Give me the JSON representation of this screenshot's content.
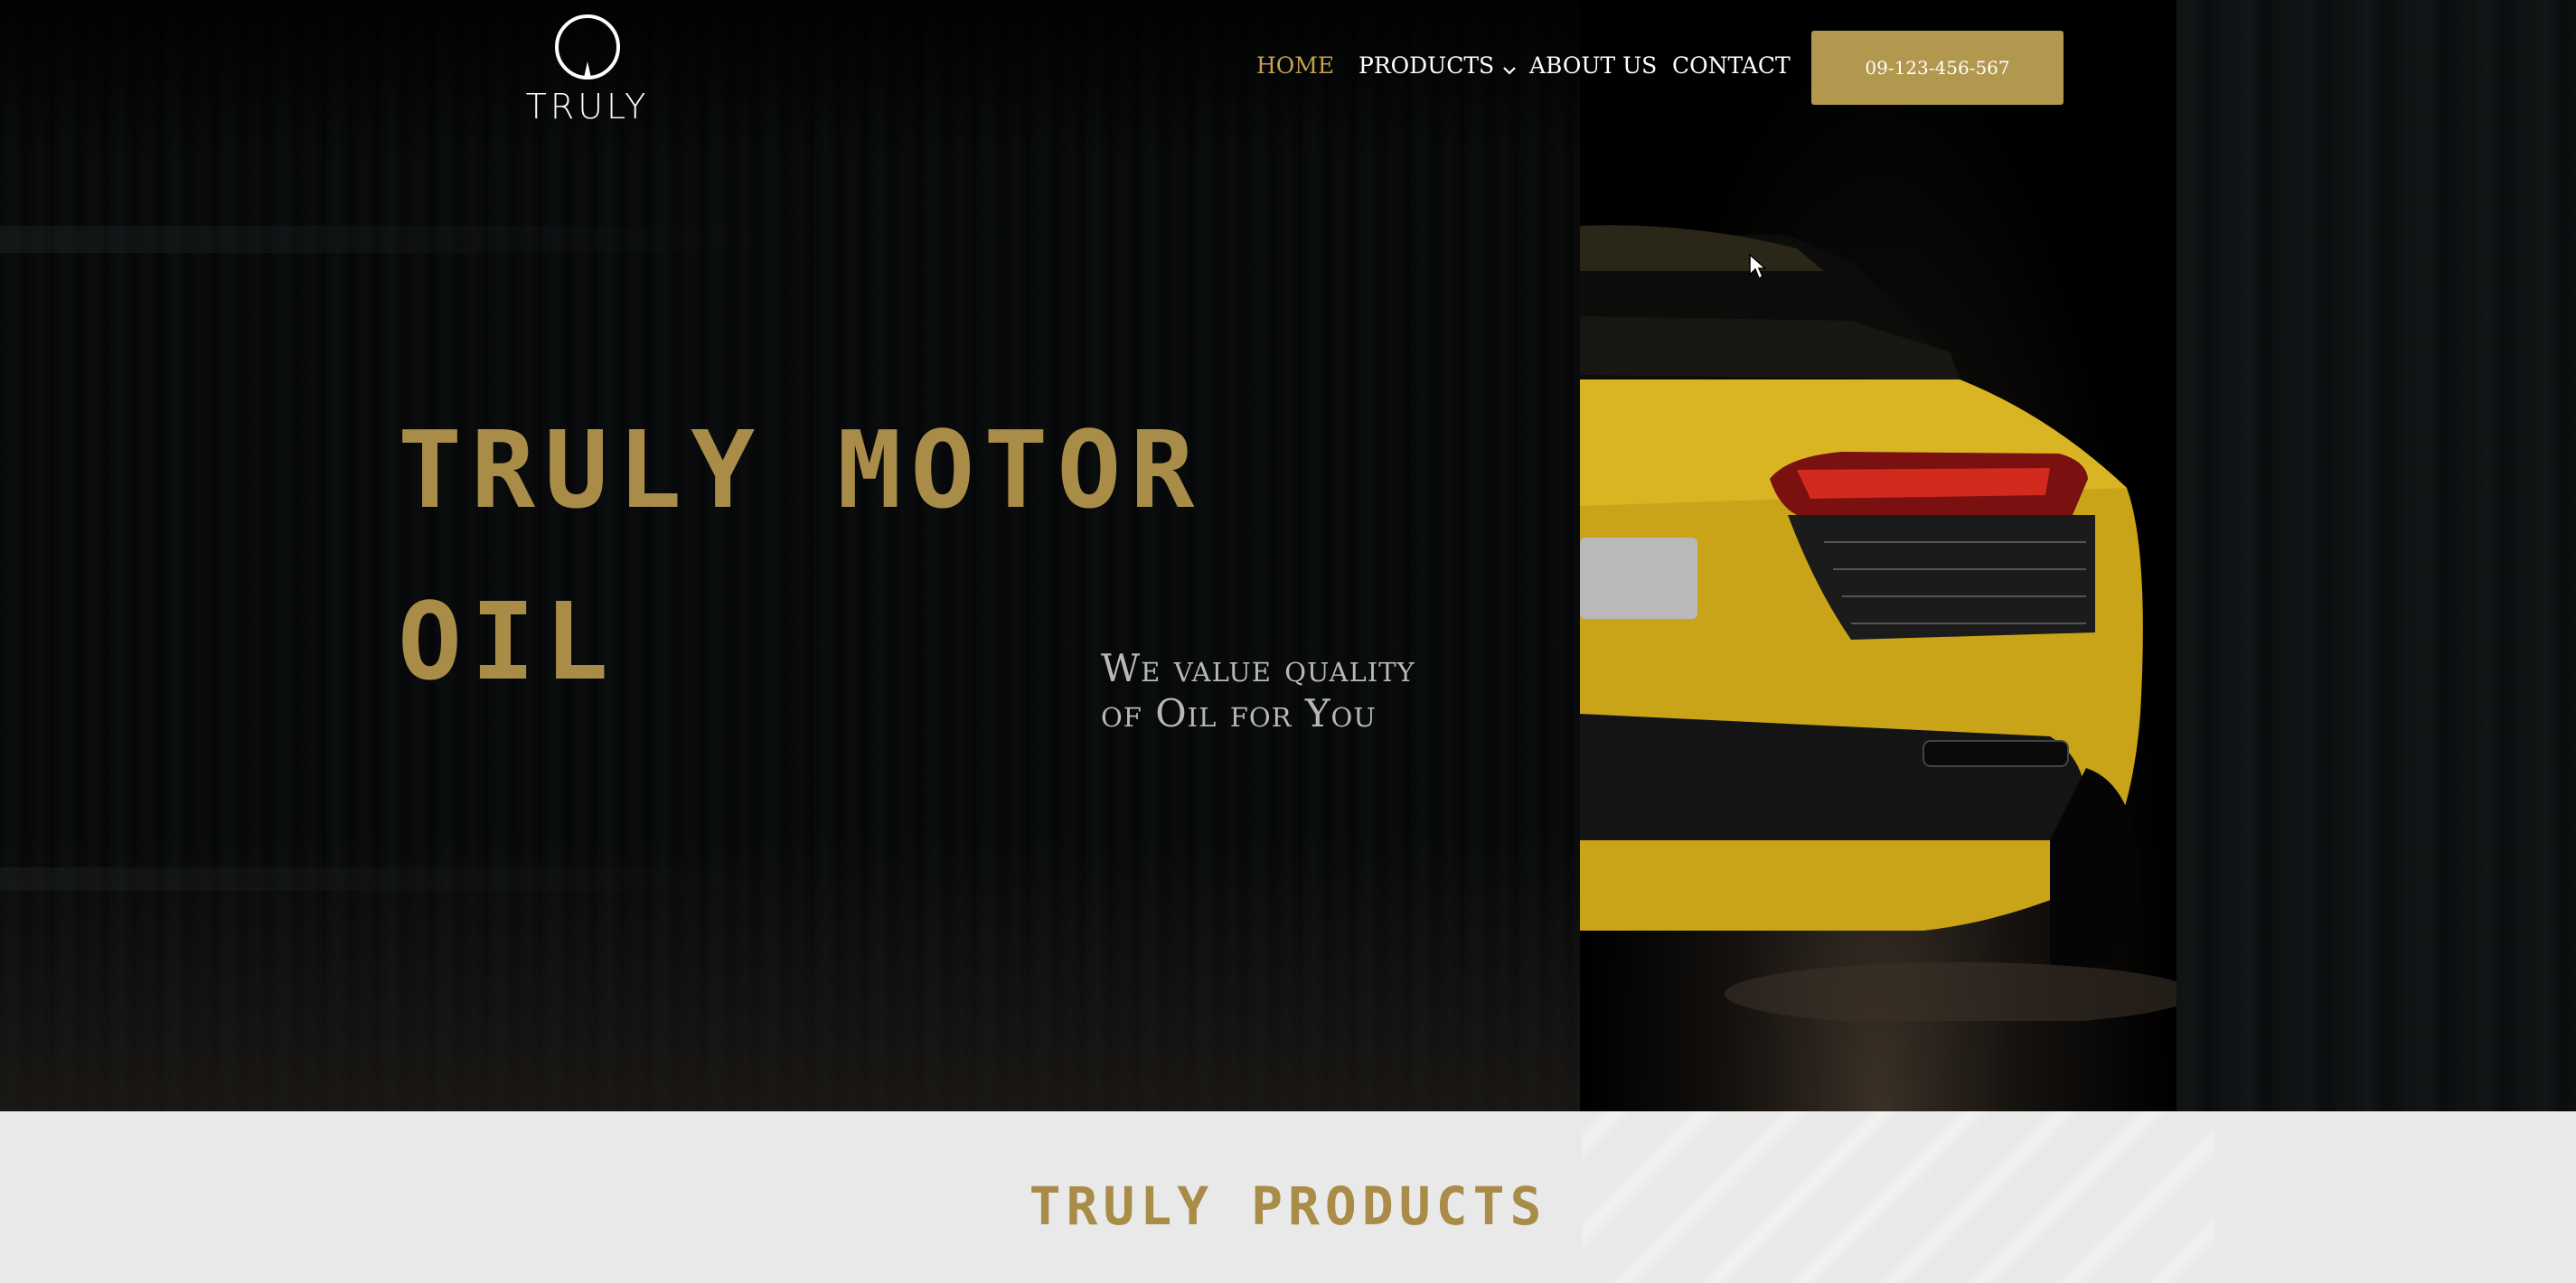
{
  "brand": {
    "logo_text": "TRULY"
  },
  "nav": {
    "items": [
      {
        "label": "HOME",
        "active": true
      },
      {
        "label": "PRODUCTS",
        "has_dropdown": true
      },
      {
        "label": "ABOUT US"
      },
      {
        "label": "CONTACT"
      }
    ]
  },
  "cta": {
    "phone": "09-123-456-567"
  },
  "hero": {
    "title_line1": "TRULY MOTOR",
    "title_line2": "OIL",
    "subtitle_line1": "We value quality",
    "subtitle_line2": "of Oil for You"
  },
  "products_section": {
    "title": "TRULY PRODUCTS"
  },
  "colors": {
    "accent_gold": "#b2974f",
    "title_gold": "#a88c48",
    "nav_active": "#c4a24f",
    "background": "#07090a",
    "section_bg": "#e9e9e9"
  },
  "icons": [
    "truly-logo-icon",
    "chevron-down-icon",
    "mouse-cursor-icon"
  ]
}
